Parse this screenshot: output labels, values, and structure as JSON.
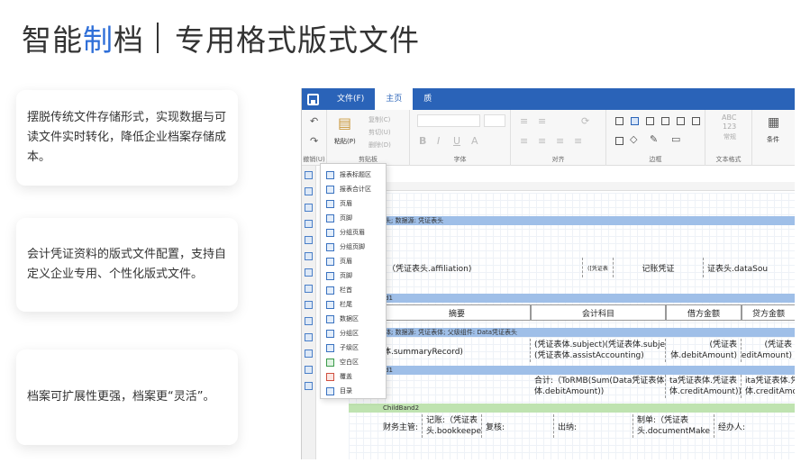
{
  "title": {
    "part1": "智能",
    "highlight": "制",
    "part2": "档",
    "subtitle": "专用格式版式文件"
  },
  "cards": [
    "摆脱传统文件存储形式，实现数据与可读文件实时转化，降低企业档案存储成本。",
    "会计凭证资料的版式文件配置，支持自定义企业专用、个性化版式文件。",
    "档案可扩展性更强，档案更“灵活”。"
  ],
  "app": {
    "tabs": [
      "文件(F)",
      "主页",
      "质"
    ],
    "ribbon_groups": [
      "撤销(U)",
      "剪贴板",
      "字体",
      "对齐",
      "边框",
      "文本格式",
      "条件"
    ],
    "clipboard": {
      "paste": "粘贴(P)",
      "copy": "复制(C)",
      "cut": "剪切(U)",
      "delete": "删除(D)"
    },
    "text_format_sample": [
      "ABC",
      "123",
      "常规"
    ],
    "dropdown_items": [
      "报表标题区",
      "报表合计区",
      "页眉",
      "页脚",
      "分组页眉",
      "分组页脚",
      "页眉",
      "页脚",
      "栏首",
      "栏尾",
      "数据区",
      "分组区",
      "子级区",
      "空白区",
      "覆盖",
      "目录"
    ],
    "bands": {
      "b1": "头; 数据源: 凭证表头",
      "b2": "d1",
      "b3": "体; 数据源: 凭证表体; 父级组件: Data凭证表头",
      "b4": "d1",
      "b5": "ChildBand2"
    },
    "row_header": {
      "c1": ":（凭证表头.affiliation)",
      "c2": "记账凭证",
      "c3": "证表头.dataSou",
      "tiny": "([凭证表"
    },
    "col_headers": [
      "摘要",
      "会计科目",
      "借方金额",
      "贷方金额"
    ],
    "row_body": {
      "c1": "体.summaryRecord)",
      "c2a": "(凭证表体.subject)(凭证表体.subje",
      "c2b": "(凭证表体.assistAccounting)",
      "c3a": "(凭证表",
      "c3b": "体.debitAmount)",
      "c4a": "(凭证表",
      "c4b": "体.creditAmount)"
    },
    "row_sum": {
      "c1a": "合计:（ToRMB(Sum(Data凭证表体",
      "c1b": "体.debitAmount))",
      "c2a": "ta凭证表体.凭证表",
      "c2b": "体.creditAmount))",
      "c3a": "ita凭证表体.凭证表",
      "c3b": "体.creditAmount))"
    },
    "row_footer": {
      "f1": "财务主管:",
      "f2a": "记账:（凭证表",
      "f2b": "头.bookkeeper",
      "f3": "复核:",
      "f4": "出纳:",
      "f5a": "制单:（凭证表",
      "f5b": "头.documentMake",
      "f6": "经办人:"
    }
  }
}
